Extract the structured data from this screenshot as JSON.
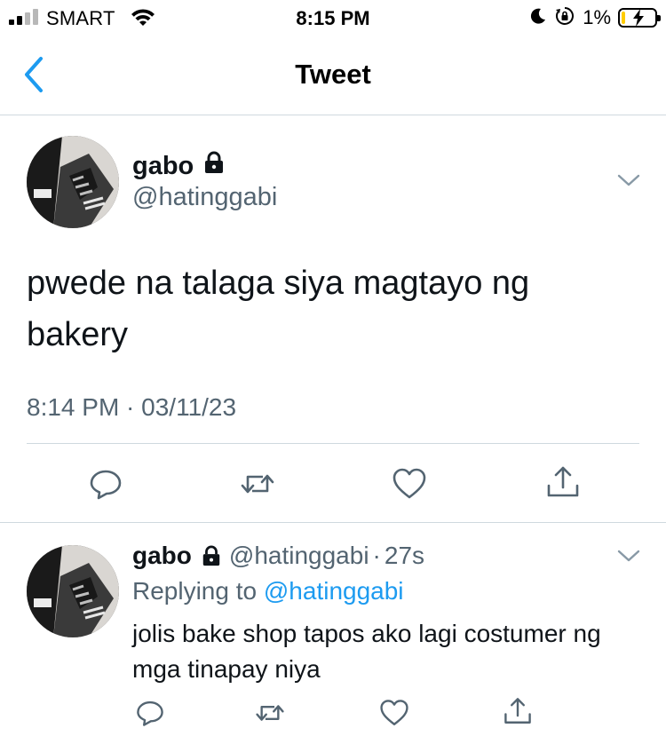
{
  "status_bar": {
    "carrier": "SMART",
    "time": "8:15 PM",
    "battery_percent": "1%",
    "icons": [
      "signal-icon",
      "wifi-icon",
      "moon-icon",
      "orientation-lock-icon",
      "battery-charging-icon"
    ]
  },
  "nav": {
    "title": "Tweet",
    "back_icon": "chevron-left-icon"
  },
  "main_tweet": {
    "name": "gabo",
    "handle": "@hatinggabi",
    "protected_icon": "lock-icon",
    "text": "pwede na talaga siya magtayo ng bakery",
    "timestamp": "8:14 PM · 03/11/23",
    "actions": [
      "reply-icon",
      "retweet-icon",
      "like-icon",
      "share-icon"
    ]
  },
  "reply_tweet": {
    "name": "gabo",
    "handle": "@hatinggabi",
    "separator": "·",
    "time": "27s",
    "replying_prefix": "Replying to",
    "replying_to": "@hatinggabi",
    "text": "jolis bake shop tapos ako lagi costumer ng mga tinapay niya",
    "actions": [
      "reply-icon",
      "retweet-icon",
      "like-icon",
      "share-icon"
    ]
  },
  "colors": {
    "accent": "#1d9bf0",
    "secondary_text": "#536471",
    "divider": "#cfd9de",
    "battery_low": "#ffcc00"
  }
}
